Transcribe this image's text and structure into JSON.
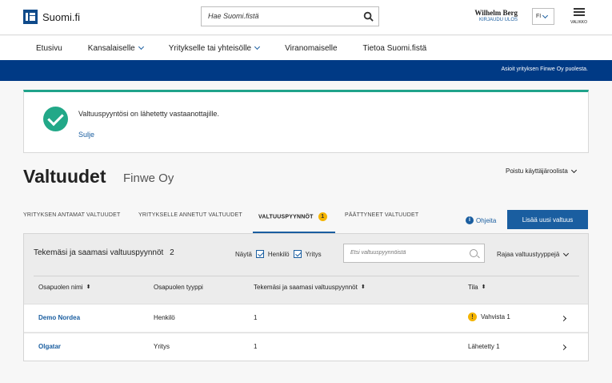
{
  "header": {
    "logo_text": "Suomi.fi",
    "search_placeholder": "Hae Suomi.fistä",
    "user_name": "Wilhelm Berg",
    "logout_label": "KIRJAUDU ULOS",
    "language": "FI",
    "menu_label": "VALIKKO"
  },
  "nav": {
    "items": [
      {
        "label": "Etusivu",
        "has_dropdown": false
      },
      {
        "label": "Kansalaiselle",
        "has_dropdown": true
      },
      {
        "label": "Yritykselle tai yhteisölle",
        "has_dropdown": true
      },
      {
        "label": "Viranomaiselle",
        "has_dropdown": false
      },
      {
        "label": "Tietoa Suomi.fistä",
        "has_dropdown": false
      }
    ]
  },
  "banner": {
    "text": "Asioit yrityksen Finwe Oy puolesta."
  },
  "notice": {
    "message": "Valtuuspyyntösi on lähetetty vastaanottajille.",
    "close_label": "Sulje",
    "accent_color": "#20a38b"
  },
  "page": {
    "title": "Valtuudet",
    "subtitle": "Finwe Oy",
    "leave_role": "Poistu käyttäjäroolista"
  },
  "tabs": [
    {
      "label": "YRITYKSEN ANTAMAT VALTUUDET",
      "active": false
    },
    {
      "label": "YRITYKSELLE ANNETUT VALTUUDET",
      "active": false
    },
    {
      "label": "VALTUUSPYYNNÖT",
      "active": true,
      "badge": "1"
    },
    {
      "label": "PÄÄTTYNEET VALTUUDET",
      "active": false
    }
  ],
  "actions": {
    "help_label": "Ohjeita",
    "add_label": "Lisää uusi valtuus"
  },
  "table": {
    "title": "Tekemäsi ja saamasi valtuuspyynnöt",
    "count": "2",
    "show_label": "Näytä",
    "filter_person": "Henkilö",
    "filter_company": "Yritys",
    "search_placeholder": "Etsi valtuuspyynnöistä",
    "type_filter": "Rajaa valtuustyyppejä",
    "columns": [
      "Osapuolen nimi",
      "Osapuolen tyyppi",
      "Tekemäsi ja saamasi valtuuspyynnöt",
      "Tila"
    ],
    "rows": [
      {
        "name": "Demo Nordea",
        "type": "Henkilö",
        "requests": "1",
        "status": "Vahvista 1",
        "warning": true
      },
      {
        "name": "Olgatar",
        "type": "Yritys",
        "requests": "1",
        "status": "Lähetetty 1",
        "warning": false
      }
    ]
  }
}
